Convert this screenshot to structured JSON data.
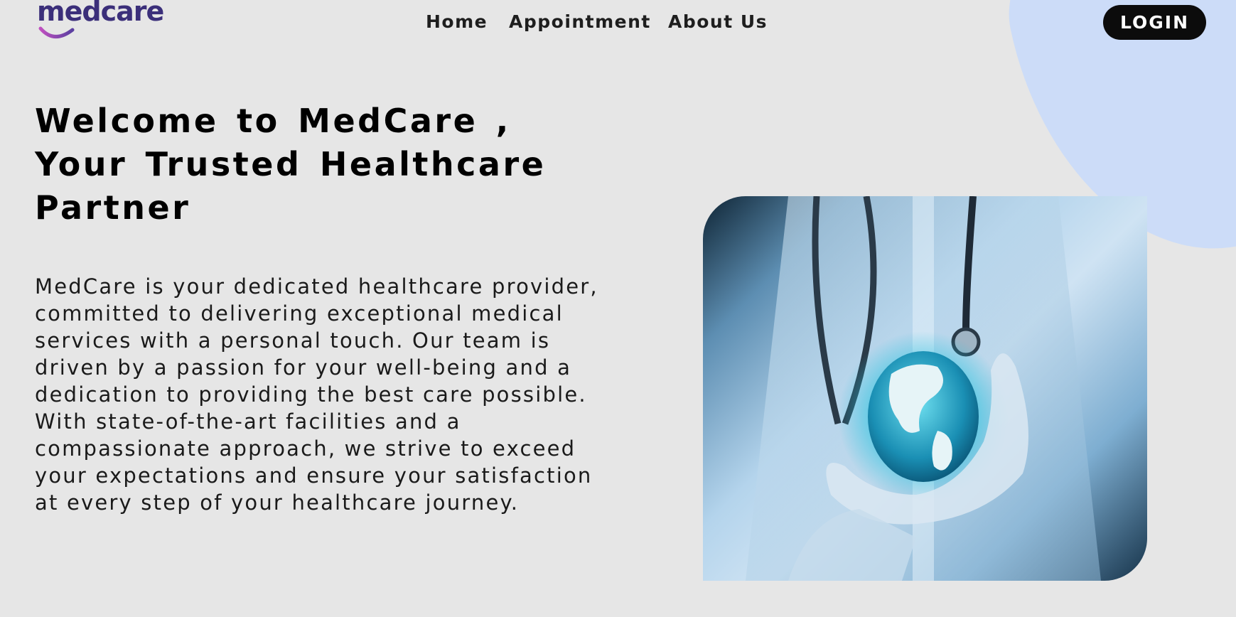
{
  "brand": {
    "logo_text": "medcare",
    "logo_color": "#3b2f7a",
    "logo_accent_color": "#a45ac8"
  },
  "nav": {
    "items": [
      {
        "label": "Home"
      },
      {
        "label": "Appointment"
      },
      {
        "label": "About Us"
      }
    ],
    "login_label": "LOGIN"
  },
  "hero": {
    "title": "Welcome to MedCare , Your Trusted Healthcare Partner",
    "description": "MedCare is your dedicated healthcare provider, committed to delivering exceptional medical services with a personal touch. Our team is driven by a passion for your well-being and a dedication to providing the best care possible. With state-of-the-art facilities and a compassionate approach, we strive to exceed your expectations and ensure your satisfaction at every step of your healthcare journey.",
    "image_icon": "doctor-holding-globe-image"
  },
  "colors": {
    "background": "#e6e6e6",
    "accent_blob": "#ccdcf8",
    "button_bg": "#0c0c0c",
    "button_text": "#ffffff"
  }
}
